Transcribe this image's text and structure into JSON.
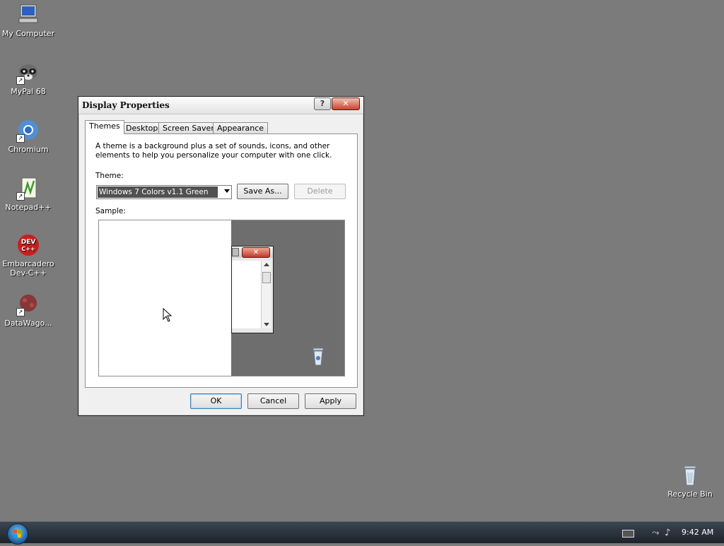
{
  "desktop": {
    "icons": [
      {
        "label": "My Computer",
        "icon": "computer-icon"
      },
      {
        "label": "MyPal 68",
        "icon": "raccoon-browser-icon"
      },
      {
        "label": "Chromium",
        "icon": "chromium-icon"
      },
      {
        "label": "Notepad++",
        "icon": "notepad-plus-plus-icon"
      },
      {
        "label": "Embarcadero Dev-C++",
        "line1": "Embarcadero",
        "line2": "Dev-C++",
        "icon": "devcpp-icon",
        "icon_text": "DEV C++"
      },
      {
        "label": "DataWago...",
        "icon": "datawagon-icon"
      },
      {
        "label": "Recycle Bin",
        "icon": "recycle-bin-icon"
      }
    ]
  },
  "dialog": {
    "title": "Display Properties",
    "help_label": "?",
    "close_label": "✕",
    "tabs": [
      {
        "label": "Themes",
        "active": true
      },
      {
        "label": "Desktop"
      },
      {
        "label": "Screen Saver"
      },
      {
        "label": "Appearance"
      }
    ],
    "description": "A theme is a background plus a set of sounds, icons, and other elements to help you personalize your computer with one click.",
    "theme_label": "Theme:",
    "theme_value": "Windows 7 Colors v1.1 Green",
    "save_as_label": "Save As...",
    "delete_label": "Delete",
    "sample_label": "Sample:",
    "sample_close": "✕",
    "ok_label": "OK",
    "cancel_label": "Cancel",
    "apply_label": "Apply"
  },
  "taskbar": {
    "clock": "9:42 AM"
  },
  "colors": {
    "desktop_bg": "#7b7b7b",
    "taskbar": "#2a323b",
    "close_red": "#c8442e"
  }
}
